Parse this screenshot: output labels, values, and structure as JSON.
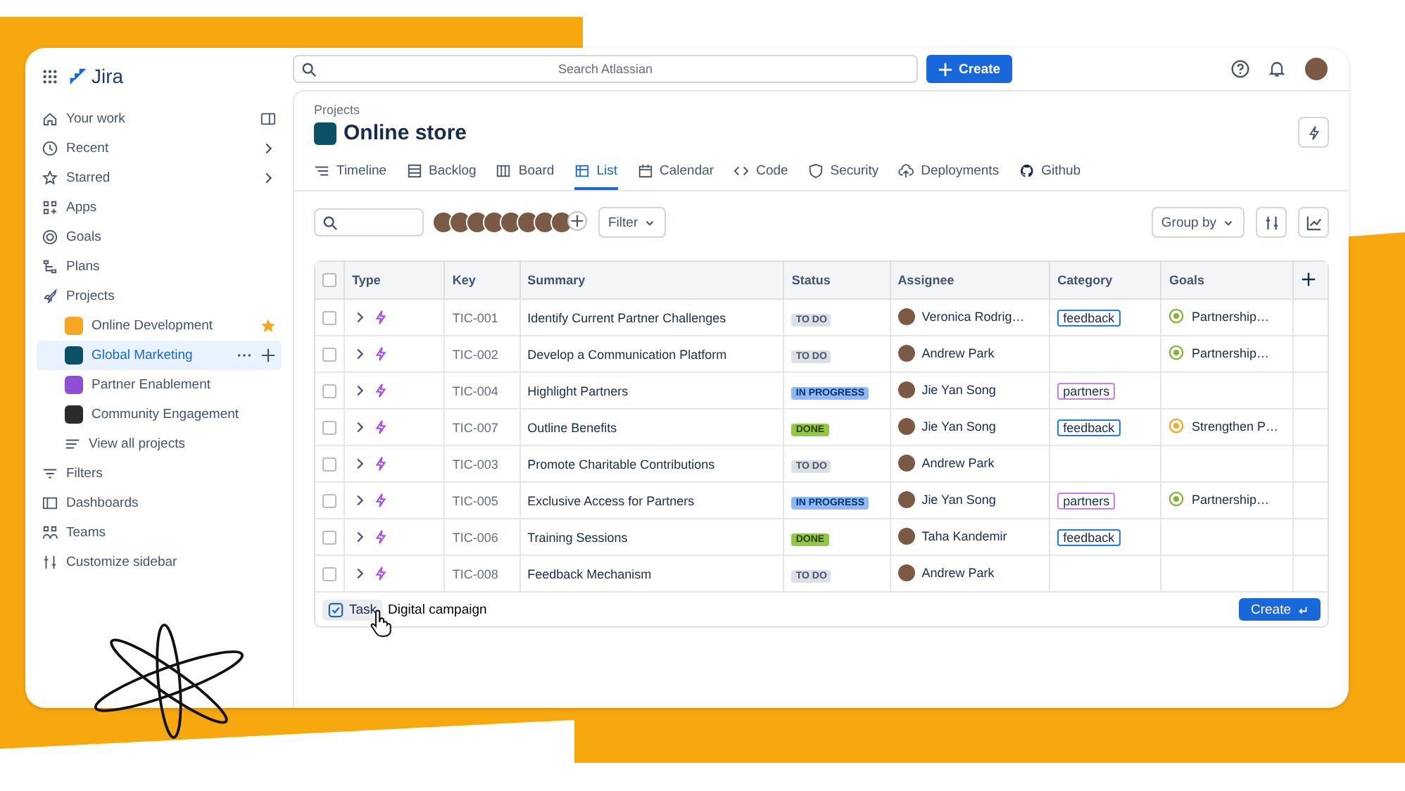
{
  "app": {
    "name": "Jira"
  },
  "search": {
    "placeholder": "Search Atlassian"
  },
  "create_button": "Create",
  "sidebar": {
    "items": [
      {
        "label": "Your work"
      },
      {
        "label": "Recent"
      },
      {
        "label": "Starred"
      },
      {
        "label": "Apps"
      },
      {
        "label": "Goals"
      },
      {
        "label": "Plans"
      },
      {
        "label": "Projects",
        "children": [
          {
            "label": "Online Development",
            "selected": false,
            "starred": true,
            "color": "#f5a623"
          },
          {
            "label": "Global Marketing",
            "selected": true,
            "starred": false,
            "color": "#0b5066"
          },
          {
            "label": "Partner Enablement",
            "selected": false,
            "starred": false,
            "color": "#8e4fd6"
          },
          {
            "label": "Community Engagement",
            "selected": false,
            "starred": false,
            "color": "#2b2b2b"
          },
          {
            "label": "View all projects",
            "kind": "link"
          }
        ]
      },
      {
        "label": "Filters"
      },
      {
        "label": "Dashboards"
      },
      {
        "label": "Teams"
      },
      {
        "label": "Customize sidebar"
      }
    ]
  },
  "project": {
    "breadcrumb": "Projects",
    "title": "Online store"
  },
  "tabs": [
    {
      "label": "Timeline",
      "selected": false
    },
    {
      "label": "Backlog",
      "selected": false
    },
    {
      "label": "Board",
      "selected": false
    },
    {
      "label": "List",
      "selected": true
    },
    {
      "label": "Calendar",
      "selected": false
    },
    {
      "label": "Code",
      "selected": false
    },
    {
      "label": "Security",
      "selected": false
    },
    {
      "label": "Deployments",
      "selected": false
    },
    {
      "label": "Github",
      "selected": false
    }
  ],
  "toolbar": {
    "filter": "Filter",
    "group_by": "Group by"
  },
  "table": {
    "columns": [
      "Type",
      "Key",
      "Summary",
      "Status",
      "Assignee",
      "Category",
      "Goals"
    ],
    "select_all": {
      "checked": false
    },
    "rows": [
      {
        "checked": false,
        "key": "TIC-001",
        "summary": "Identify Current Partner Challenges",
        "status": {
          "label": "TO DO",
          "kind": "todo"
        },
        "assignee": "Veronica Rodrig…",
        "category": {
          "label": "feedback",
          "color": "#1d7afc"
        },
        "goal": {
          "label": "Partnership…",
          "color": "#82b536"
        }
      },
      {
        "checked": false,
        "key": "TIC-002",
        "summary": "Develop a Communication Platform",
        "status": {
          "label": "TO DO",
          "kind": "todo"
        },
        "assignee": "Andrew Park",
        "goal": {
          "label": "Partnership…",
          "color": "#82b536"
        }
      },
      {
        "checked": false,
        "key": "TIC-004",
        "summary": "Highlight Partners",
        "status": {
          "label": "IN PROGRESS",
          "kind": "progress"
        },
        "assignee": "Jie Yan Song",
        "category": {
          "label": "partners",
          "color": "#c97cf4"
        }
      },
      {
        "checked": false,
        "key": "TIC-007",
        "summary": "Outline Benefits",
        "status": {
          "label": "DONE",
          "kind": "done"
        },
        "assignee": "Jie Yan Song",
        "category": {
          "label": "feedback",
          "color": "#1d7afc"
        },
        "goal": {
          "label": "Strengthen P…",
          "color": "#f5a623"
        }
      },
      {
        "checked": false,
        "key": "TIC-003",
        "summary": "Promote Charitable Contributions",
        "status": {
          "label": "TO DO",
          "kind": "todo"
        },
        "assignee": "Andrew Park"
      },
      {
        "checked": false,
        "key": "TIC-005",
        "summary": "Exclusive Access for Partners",
        "status": {
          "label": "IN PROGRESS",
          "kind": "progress"
        },
        "assignee": "Jie Yan Song",
        "category": {
          "label": "partners",
          "color": "#c97cf4"
        },
        "goal": {
          "label": "Partnership…",
          "color": "#82b536"
        }
      },
      {
        "checked": false,
        "key": "TIC-006",
        "summary": "Training Sessions",
        "status": {
          "label": "DONE",
          "kind": "done"
        },
        "assignee": "Taha Kandemir",
        "category": {
          "label": "feedback",
          "color": "#1d7afc"
        }
      },
      {
        "checked": false,
        "key": "TIC-008",
        "summary": "Feedback Mechanism",
        "status": {
          "label": "TO DO",
          "kind": "todo"
        },
        "assignee": "Andrew Park"
      }
    ]
  },
  "new_item": {
    "type": "Task",
    "value": "Digital campaign",
    "button": "Create"
  }
}
